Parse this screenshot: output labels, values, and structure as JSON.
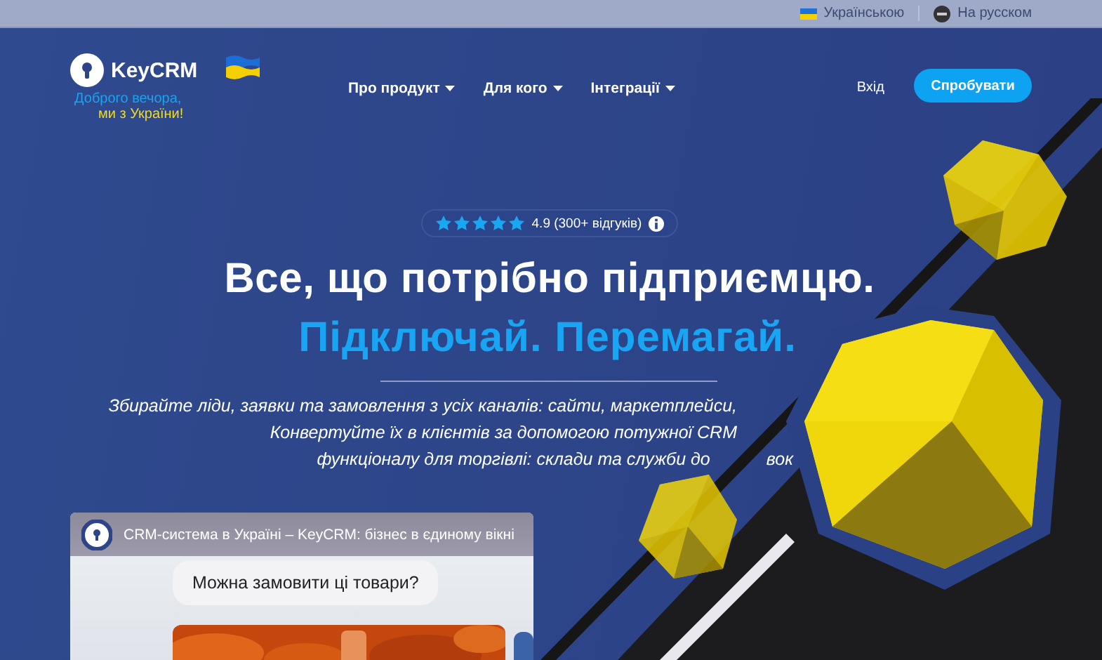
{
  "language_bar": {
    "items": [
      {
        "kind": "flag",
        "label": "Українською"
      },
      {
        "kind": "blocked",
        "label": "На русском"
      }
    ]
  },
  "header": {
    "logo": "KeyCRM",
    "greeting_line_1": "Доброго вечора,",
    "greeting_line_2": "ми з України!",
    "nav": [
      {
        "label": "Про продукт"
      },
      {
        "label": "Для кого"
      },
      {
        "label": "Інтеграції"
      }
    ],
    "login": "Вхід",
    "cta": "Спробувати"
  },
  "hero": {
    "rating": {
      "stars": 5,
      "text": "4.9 (300+ відгуків)"
    },
    "title": "Все, що потрібно підприємцю.",
    "subtitle": "Підключай. Перемагай.",
    "description": [
      "Збирайте ліди, заявки та замовлення з усіх каналів: сайти, маркетплейси,",
      "Конвертуйте їх в клієнтів за допомогою потужної CRM",
      "функціоналу для торгівлі: склади та служби до"
    ],
    "description_tail": "вок"
  },
  "video": {
    "title": "CRM-система в Україні – KeyCRM: бізнес в єдиному вікні",
    "chat_message": "Можна замовити ці товари?"
  }
}
